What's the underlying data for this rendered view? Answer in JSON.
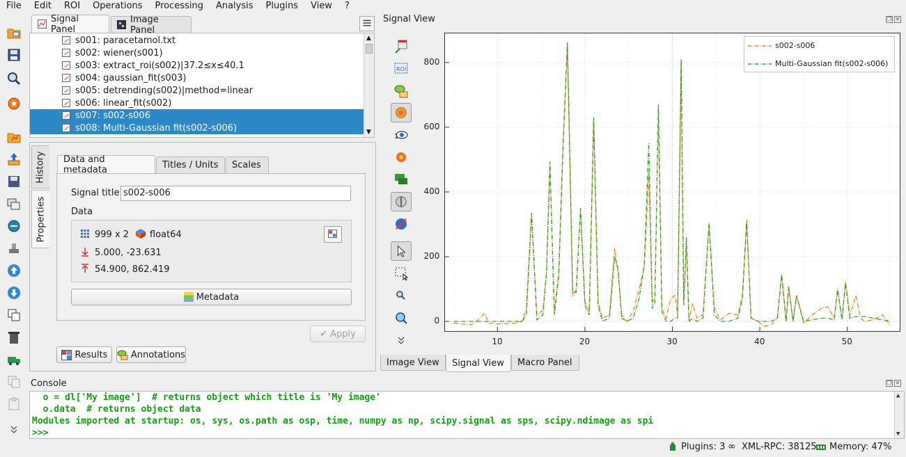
{
  "menubar": {
    "items": [
      "File",
      "Edit",
      "ROI",
      "Operations",
      "Processing",
      "Analysis",
      "Plugins",
      "View",
      "?"
    ]
  },
  "panel_tabs": {
    "signal_panel": "Signal Panel",
    "image_panel": "Image Panel"
  },
  "signal_list": {
    "items": [
      {
        "label": "s001: paracetamol.txt",
        "selected": false
      },
      {
        "label": "s002: wiener(s001)",
        "selected": false
      },
      {
        "label": "s003: extract_roi(s002)|37.2≤x≤40.1",
        "selected": false
      },
      {
        "label": "s004: gaussian_fit(s003)",
        "selected": false
      },
      {
        "label": "s005: detrending(s002)|method=linear",
        "selected": false
      },
      {
        "label": "s006: linear_fit(s002)",
        "selected": false
      },
      {
        "label": "s007: s002-s006",
        "selected": true
      },
      {
        "label": "s008: Multi-Gaussian fit(s002-s006)",
        "selected": true
      }
    ]
  },
  "side_tabs": {
    "history": "History",
    "properties": "Properties"
  },
  "props_tabs": {
    "data_metadata": "Data and metadata",
    "titles_units": "Titles / Units",
    "scales": "Scales"
  },
  "properties": {
    "signal_title_label": "Signal title",
    "signal_title_value": "s002-s006",
    "data_label": "Data",
    "shape": "999 x 2",
    "dtype": "float64",
    "min_values": "5.000, -23.631",
    "max_values": "54.900, 862.419",
    "metadata_button": "Metadata",
    "apply_button": "Apply",
    "results_button": "Results",
    "annotations_button": "Annotations"
  },
  "signal_view": {
    "title": "Signal View"
  },
  "bottom_tabs": {
    "image_view": "Image View",
    "signal_view": "Signal View",
    "macro_panel": "Macro Panel"
  },
  "console": {
    "title": "Console",
    "lines": [
      "  o = dl['My image']  # returns object which title is 'My image'",
      "  o.data  # returns object data",
      "Modules imported at startup: os, sys, os.path as osp, time, numpy as np, scipy.signal as sps, scipy.ndimage as spi",
      ">>>"
    ]
  },
  "statusbar": {
    "plugins": "Plugins: 3",
    "xmlrpc": "XML-RPC: 38125",
    "memory": "Memory: 47%"
  },
  "colors": {
    "series1": "#ff7f0e",
    "series2": "#2ca02c",
    "selection": "#2d88c8"
  },
  "chart_data": {
    "type": "line",
    "title": "",
    "xlabel": "",
    "ylabel": "",
    "xlim": [
      4,
      56
    ],
    "ylim": [
      -30,
      890
    ],
    "xticks": [
      10,
      20,
      30,
      40,
      50
    ],
    "yticks": [
      0,
      200,
      400,
      600,
      800
    ],
    "grid": true,
    "legend_position": "top-right",
    "series": [
      {
        "name": "s002-s006",
        "style": "dash-dot",
        "color": "#ff7f0e",
        "x": [
          5,
          6,
          7,
          7.8,
          8.5,
          9,
          10,
          11,
          12,
          12.8,
          13.3,
          13.9,
          14.5,
          15.2,
          15.6,
          16,
          16.5,
          17,
          17.5,
          18,
          18.6,
          19,
          19.5,
          20,
          20.5,
          21,
          21.5,
          22,
          22.8,
          23.4,
          23.8,
          24.2,
          24.8,
          25.5,
          26.2,
          26.8,
          27.3,
          27.7,
          28,
          28.4,
          28.8,
          29.3,
          29.8,
          30.3,
          30.6,
          31,
          31.3,
          31.6,
          31.9,
          32.3,
          32.8,
          33.5,
          34.2,
          34.8,
          35.5,
          36.5,
          37.5,
          38,
          38.5,
          39,
          39.8,
          40.5,
          41.3,
          42,
          42.5,
          43,
          43.3,
          43.8,
          44.2,
          45,
          46,
          47,
          47.8,
          48.5,
          48.9,
          49.4,
          49.8,
          50.3,
          51,
          51.5,
          52,
          53,
          54,
          54.5,
          54.9
        ],
        "y": [
          -5,
          -8,
          -10,
          5,
          25,
          -5,
          -8,
          -7,
          -5,
          0,
          40,
          330,
          20,
          35,
          150,
          475,
          30,
          150,
          550,
          855,
          80,
          100,
          345,
          60,
          30,
          625,
          60,
          10,
          20,
          225,
          150,
          20,
          0,
          30,
          100,
          170,
          460,
          60,
          70,
          660,
          40,
          10,
          70,
          80,
          20,
          800,
          60,
          240,
          0,
          55,
          10,
          20,
          300,
          40,
          5,
          25,
          20,
          80,
          315,
          10,
          0,
          -15,
          -10,
          10,
          145,
          0,
          110,
          0,
          80,
          -5,
          20,
          40,
          45,
          10,
          95,
          10,
          120,
          20,
          80,
          10,
          0,
          5,
          20,
          5,
          -15
        ]
      },
      {
        "name": "Multi-Gaussian fit(s002-s006)",
        "style": "dash-dot",
        "color": "#2ca02c",
        "x": [
          5,
          7,
          9,
          11,
          12.8,
          13.3,
          13.9,
          14.5,
          15.2,
          15.6,
          16,
          16.5,
          17,
          17.5,
          18,
          18.6,
          19,
          19.5,
          20,
          20.5,
          21,
          21.5,
          22,
          22.8,
          23.4,
          23.8,
          24.2,
          24.8,
          25.5,
          26.2,
          26.8,
          27.3,
          27.7,
          28,
          28.4,
          28.8,
          29.3,
          29.8,
          30.3,
          30.6,
          31,
          31.3,
          31.6,
          31.9,
          32.3,
          32.8,
          33.5,
          34.2,
          34.8,
          35.5,
          36.5,
          37.5,
          38,
          38.5,
          39,
          39.8,
          40.5,
          41.3,
          42,
          42.5,
          43,
          43.3,
          43.8,
          44.2,
          45,
          46,
          47,
          47.8,
          48.5,
          48.9,
          49.4,
          49.8,
          50.3,
          51,
          52,
          53,
          54,
          54.9
        ],
        "y": [
          0,
          0,
          0,
          0,
          0,
          20,
          335,
          5,
          20,
          150,
          495,
          20,
          140,
          540,
          862,
          90,
          90,
          350,
          50,
          20,
          630,
          50,
          0,
          10,
          200,
          160,
          10,
          0,
          10,
          70,
          180,
          550,
          40,
          60,
          670,
          30,
          0,
          0,
          10,
          10,
          810,
          50,
          260,
          0,
          10,
          0,
          10,
          305,
          20,
          0,
          0,
          10,
          70,
          305,
          10,
          0,
          0,
          0,
          10,
          145,
          0,
          105,
          0,
          80,
          0,
          5,
          10,
          10,
          5,
          100,
          5,
          120,
          10,
          15,
          15,
          10,
          5,
          0
        ]
      }
    ]
  }
}
